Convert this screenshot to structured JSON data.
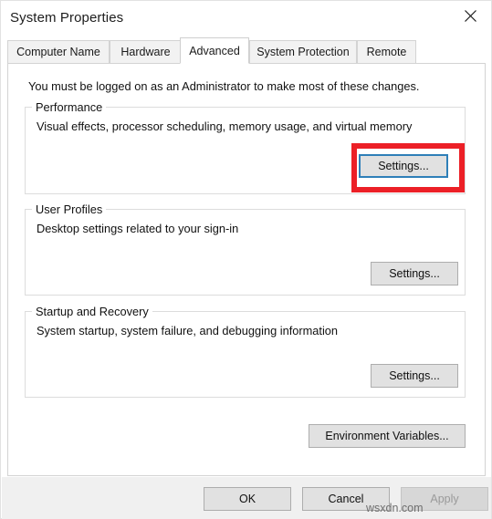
{
  "window": {
    "title": "System Properties",
    "close_icon": "close-icon"
  },
  "tabs": [
    {
      "label": "Computer Name",
      "selected": false
    },
    {
      "label": "Hardware",
      "selected": false
    },
    {
      "label": "Advanced",
      "selected": true
    },
    {
      "label": "System Protection",
      "selected": false
    },
    {
      "label": "Remote",
      "selected": false
    }
  ],
  "main": {
    "notice": "You must be logged on as an Administrator to make most of these changes.",
    "groups": [
      {
        "title": "Performance",
        "description": "Visual effects, processor scheduling, memory usage, and virtual memory",
        "button_label": "Settings...",
        "highlighted": true
      },
      {
        "title": "User Profiles",
        "description": "Desktop settings related to your sign-in",
        "button_label": "Settings...",
        "highlighted": false
      },
      {
        "title": "Startup and Recovery",
        "description": "System startup, system failure, and debugging information",
        "button_label": "Settings...",
        "highlighted": false
      }
    ],
    "environment_variables_label": "Environment Variables..."
  },
  "footer": {
    "ok_label": "OK",
    "cancel_label": "Cancel",
    "apply_label": "Apply",
    "apply_disabled": true
  },
  "watermark": "wsxdn.com",
  "colors": {
    "highlight_red": "#ec2027",
    "focus_blue": "#2e7fb8",
    "button_face": "#e1e1e1",
    "window_bg": "#ffffff",
    "footer_bg": "#f0f0f0"
  }
}
